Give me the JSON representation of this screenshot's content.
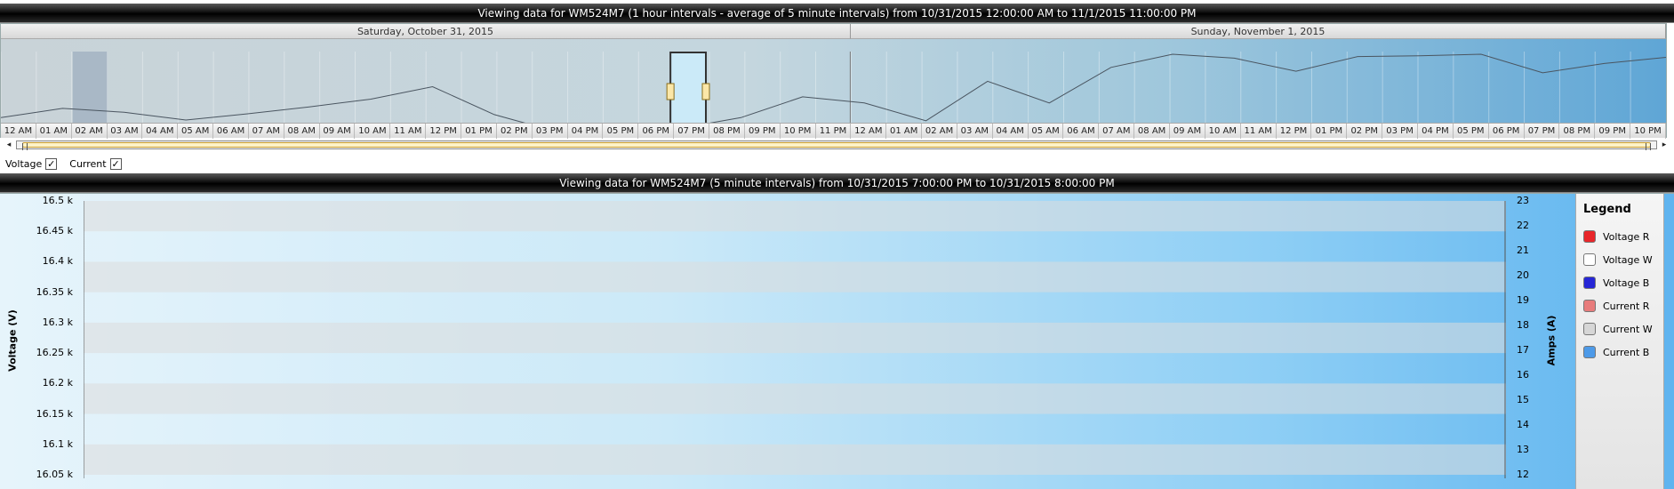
{
  "overview": {
    "title": "Viewing data for WM524M7 (1 hour intervals - average of 5 minute intervals) from 10/31/2015 12:00:00 AM to 11/1/2015 11:00:00 PM",
    "days": [
      "Saturday, October 31, 2015",
      "Sunday, November 1, 2015"
    ],
    "hours": [
      "12 AM",
      "01 AM",
      "02 AM",
      "03 AM",
      "04 AM",
      "05 AM",
      "06 AM",
      "07 AM",
      "08 AM",
      "09 AM",
      "10 AM",
      "11 AM",
      "12 PM",
      "01 PM",
      "02 PM",
      "03 PM",
      "04 PM",
      "05 PM",
      "06 PM",
      "07 PM",
      "08 PM",
      "09 PM",
      "10 PM",
      "11 PM",
      "12 AM",
      "01 AM",
      "02 AM",
      "03 AM",
      "04 AM",
      "05 AM",
      "06 AM",
      "07 AM",
      "08 AM",
      "09 AM",
      "10 AM",
      "11 AM",
      "12 PM",
      "01 PM",
      "02 PM",
      "03 PM",
      "04 PM",
      "05 PM",
      "06 PM",
      "07 PM",
      "08 PM",
      "09 PM",
      "10 PM"
    ],
    "line_values": [
      0.18,
      0.3,
      0.25,
      0.15,
      0.23,
      0.32,
      0.42,
      0.58,
      0.22,
      0.0,
      0.03,
      0.04,
      0.18,
      0.45,
      0.37,
      0.14,
      0.65,
      0.37,
      0.83,
      1.0,
      0.95,
      0.78,
      0.97,
      0.98,
      1.0,
      0.76,
      0.88,
      0.96
    ],
    "selected_hour_index": 19,
    "highlight_hour_index": 2
  },
  "scrollbar": {
    "left_arrow": "◂",
    "right_arrow": "▸"
  },
  "toggles": [
    {
      "label": "Voltage",
      "checked": "✓"
    },
    {
      "label": "Current",
      "checked": "✓"
    }
  ],
  "detail": {
    "title": "Viewing data for WM524M7 (5 minute intervals) from 10/31/2015 7:00:00 PM to 10/31/2015 8:00:00 PM",
    "y_left_label": "Voltage (V)",
    "y_right_label": "Amps (A)",
    "y_left_ticks": [
      "16.5 k",
      "16.45 k",
      "16.4 k",
      "16.35 k",
      "16.3 k",
      "16.25 k",
      "16.2 k",
      "16.15 k",
      "16.1 k",
      "16.05 k"
    ],
    "y_right_ticks": [
      "23",
      "22",
      "21",
      "20",
      "19",
      "18",
      "17",
      "16",
      "15",
      "14",
      "13",
      "12"
    ]
  },
  "legend": {
    "title": "Legend",
    "items": [
      {
        "label": "Voltage R",
        "color": "#e8262a"
      },
      {
        "label": "Voltage W",
        "color": "#ffffff"
      },
      {
        "label": "Voltage B",
        "color": "#2626d6"
      },
      {
        "label": "Current R",
        "color": "#e87c7c"
      },
      {
        "label": "Current W",
        "color": "#d6d6d6"
      },
      {
        "label": "Current B",
        "color": "#4d9ae8"
      }
    ]
  }
}
